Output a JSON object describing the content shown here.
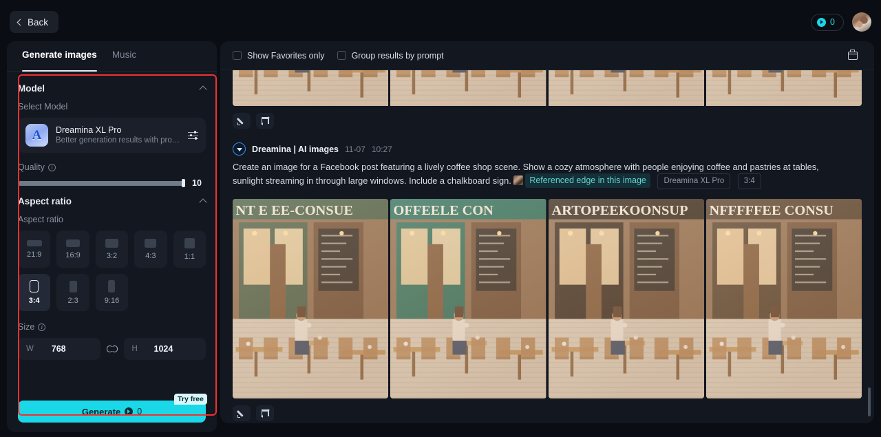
{
  "topbar": {
    "back_label": "Back",
    "credit_count": "0",
    "avatar_name": "user-avatar"
  },
  "left_panel": {
    "tabs": [
      {
        "label": "Generate images",
        "active": true
      },
      {
        "label": "Music",
        "active": false
      }
    ],
    "model_section": {
      "title": "Model",
      "sub_label": "Select Model",
      "model_name": "Dreamina XL Pro",
      "model_desc": "Better generation results with profe…",
      "model_icon_letter": "A"
    },
    "quality": {
      "label": "Quality",
      "value": "10",
      "percent": 100
    },
    "aspect_ratio_section": {
      "title": "Aspect ratio",
      "sub_label": "Aspect ratio",
      "options": [
        {
          "label": "21:9",
          "w": 22,
          "h": 9,
          "selected": false
        },
        {
          "label": "16:9",
          "w": 20,
          "h": 11,
          "selected": false
        },
        {
          "label": "3:2",
          "w": 19,
          "h": 13,
          "selected": false
        },
        {
          "label": "4:3",
          "w": 17,
          "h": 13,
          "selected": false
        },
        {
          "label": "1:1",
          "w": 15,
          "h": 15,
          "selected": false
        },
        {
          "label": "3:4",
          "w": 13,
          "h": 18,
          "selected": true
        },
        {
          "label": "2:3",
          "w": 11,
          "h": 17,
          "selected": false
        },
        {
          "label": "9:16",
          "w": 10,
          "h": 18,
          "selected": false
        }
      ]
    },
    "size": {
      "label": "Size",
      "width_key": "W",
      "width_value": "768",
      "height_key": "H",
      "height_value": "1024",
      "link_state": "linked"
    },
    "generate": {
      "label": "Generate",
      "cost": "0",
      "badge": "Try free"
    }
  },
  "right_panel": {
    "filters": [
      {
        "label": "Show Favorites only",
        "checked": false
      },
      {
        "label": "Group results by prompt",
        "checked": false
      }
    ],
    "gallery_button": "gallery-icon",
    "top_result": {
      "actions": [
        "edit",
        "regenerate"
      ],
      "thumbs": 4
    },
    "post": {
      "author": "Dreamina | AI images",
      "date": "11-07",
      "time": "10:27",
      "prompt_text": "Create an image for a Facebook post featuring a lively coffee shop scene. Show a cozy atmosphere with people enjoying coffee and pastries at tables, sunlight streaming in through large windows. Include a chalkboard sign.",
      "reference_chip": "Referenced edge in this image",
      "tags": [
        "Dreamina XL Pro",
        "3:4"
      ],
      "actions": [
        "edit",
        "regenerate"
      ],
      "results": [
        {
          "sign_text": "NT E   EE-CONSUE",
          "accent": "#3f5b45",
          "caption": "wooden cafe facade, woman at table"
        },
        {
          "sign_text": "OFFEELE CON",
          "accent": "#1f6b5c",
          "caption": "green cafe front, CAFE and COFFEE windows"
        },
        {
          "sign_text": "ARTOPEEKOONSUP",
          "accent": "#2a2018",
          "caption": "dark wood cafe, lantern, chalkboard"
        },
        {
          "sign_text": "NFFFFFEE CONSU",
          "accent": "#4a3625",
          "caption": "CAFE window, warm wood storefront"
        }
      ]
    },
    "colors": {
      "accent": "#1ad8e8",
      "panel_bg": "#131720",
      "page_bg": "#0a0d14",
      "highlight_box": "#f23030",
      "chip_teal": "#63d6d0"
    }
  }
}
